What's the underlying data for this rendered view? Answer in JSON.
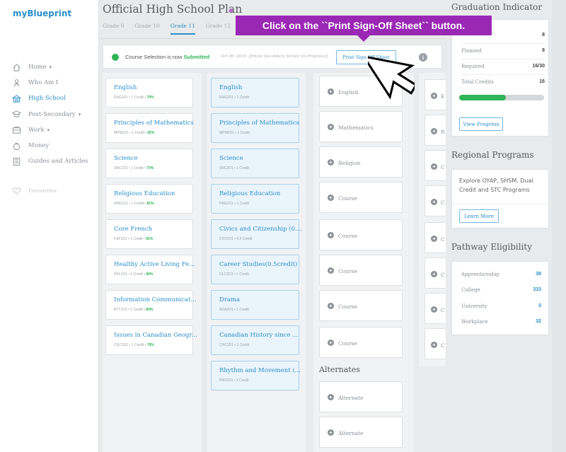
{
  "app": {
    "logo": "myBlueprint"
  },
  "sidebar": {
    "items": [
      {
        "label": "Home",
        "caret": "▾",
        "icon": "home-icon"
      },
      {
        "label": "Who Am I",
        "caret": "",
        "icon": "person-icon"
      },
      {
        "label": "High School",
        "caret": "",
        "icon": "school-icon"
      },
      {
        "label": "Post-Secondary",
        "caret": "▾",
        "icon": "grad-cap-icon"
      },
      {
        "label": "Work",
        "caret": "▾",
        "icon": "briefcase-icon"
      },
      {
        "label": "Money",
        "caret": "",
        "icon": "money-icon"
      },
      {
        "label": "Guides and Articles",
        "caret": "",
        "icon": "book-icon"
      }
    ],
    "favourites": "Favourites"
  },
  "header": {
    "title": "Official High School Plan",
    "tabs": [
      "Grade 9",
      "Grade 10",
      "Grade 11",
      "Grade 12"
    ],
    "active_tab": "Grade 11"
  },
  "status": {
    "prefix": "Course Selection is now ",
    "state": "Submitted",
    "date": "Oct 06, 2016, [Pinxte Secondary School (in-Progress)]",
    "print_button": "Print Sign-Off Sheet",
    "info_symbol": "i"
  },
  "columns": {
    "grade9": [
      {
        "name": "English",
        "meta": "ENG1D1 • 1 Credit • ",
        "grade": "70%"
      },
      {
        "name": "Principles of Mathematics",
        "meta": "MPM1D1 • 1 Credit • ",
        "grade": "65%"
      },
      {
        "name": "Science",
        "meta": "SNC1D1 • 1 Credit • ",
        "grade": "70%"
      },
      {
        "name": "Religious Education",
        "meta": "HRE1O1 • 1 Credit • ",
        "grade": "81%"
      },
      {
        "name": "Core French",
        "meta": "FSF1D1 • 1 Credit • ",
        "grade": "81%"
      },
      {
        "name": "Healthy Active Living Fe...",
        "meta": "PPL1O1 • 1 Credit • ",
        "grade": "80%"
      },
      {
        "name": "Information Communicat...",
        "meta": "BTT1O1 • 1 Credit • ",
        "grade": "80%"
      },
      {
        "name": "Issues in Canadian Geogr...",
        "meta": "CGC1D1 • 1 Credit • ",
        "grade": "70%"
      }
    ],
    "grade10": [
      {
        "name": "English",
        "meta": "ENG2D1 • 1 Credit"
      },
      {
        "name": "Principles of Mathematics",
        "meta": "MPM2D1 • 1 Credit"
      },
      {
        "name": "Science",
        "meta": "SNC2D1 • 1 Credit"
      },
      {
        "name": "Religious Education",
        "meta": "HRE2O1 • 1 Credit"
      },
      {
        "name": "Civics and Citizenship (0....",
        "meta": "CHV2O1 • 0.5 Credit"
      },
      {
        "name": "Career Studies(0.5credit)",
        "meta": "GLC2O1 • 1 Credit"
      },
      {
        "name": "Drama",
        "meta": "ADA2O1 • 1 Credit"
      },
      {
        "name": "Canadian History since ...",
        "meta": "CHC2D1 • 1 Credit"
      },
      {
        "name": "Rhythm and Movement (...",
        "meta": "PAD2O1 • 1 Credit"
      }
    ],
    "grade11": [
      "English",
      "Mathematics",
      "Religion",
      "Course",
      "Course",
      "Course",
      "Course",
      "Course"
    ],
    "alternates_heading": "Alternates",
    "alternates": [
      "Alternate",
      "Alternate"
    ],
    "grade12": [
      "E",
      "R",
      "C",
      "C",
      "C",
      "C",
      "C",
      "C"
    ]
  },
  "graduation": {
    "title": "Graduation Indicator",
    "rows": [
      {
        "label": "",
        "value": "8"
      },
      {
        "label": "Planned",
        "value": "8"
      },
      {
        "label": "Required",
        "value": "16/30"
      },
      {
        "label": "Total Credits",
        "value": "16"
      }
    ],
    "progress_percent": 55,
    "button": "View Progress"
  },
  "regional": {
    "title": "Regional Programs",
    "text": "Explore OYAP, SHSM, Dual Credit and STC Programs",
    "button": "Learn More"
  },
  "pathway": {
    "title": "Pathway Eligibility",
    "rows": [
      {
        "label": "Apprenticeship",
        "value": "38"
      },
      {
        "label": "College",
        "value": "333"
      },
      {
        "label": "University",
        "value": "0"
      },
      {
        "label": "Workplace",
        "value": "32"
      }
    ]
  },
  "tooltip": {
    "text": "Click on the ``Print Sign-Off Sheet`` button."
  },
  "colors": {
    "brand": "#2a8fc9",
    "success": "#2fb457",
    "tooltip": "#9a28b5"
  }
}
